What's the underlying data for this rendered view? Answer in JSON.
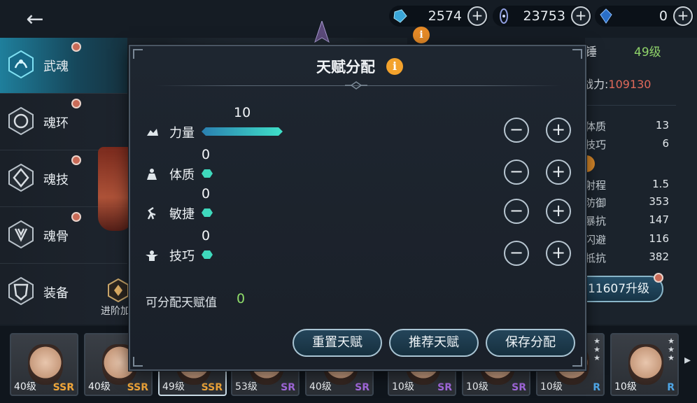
{
  "topbar": {
    "resources": [
      {
        "icon": "blue-crystal-icon",
        "value": "2574"
      },
      {
        "icon": "spirit-ring-icon",
        "value": "23753"
      },
      {
        "icon": "soul-gem-icon",
        "value": "0"
      }
    ],
    "plus_label": "+"
  },
  "sidebar": {
    "items": [
      {
        "label": "武魂",
        "icon": "martial-soul-icon",
        "active": true
      },
      {
        "label": "魂环",
        "icon": "soul-ring-icon",
        "active": false
      },
      {
        "label": "魂技",
        "icon": "soul-skill-icon",
        "active": false
      },
      {
        "label": "魂骨",
        "icon": "soul-bone-icon",
        "active": false
      },
      {
        "label": "装备",
        "icon": "equipment-icon",
        "active": false
      }
    ],
    "advance_label": "进阶加"
  },
  "right_panel": {
    "name_fragment": "锤",
    "level": "49级",
    "power_label": "战力:",
    "power_value": "109130",
    "stats": [
      {
        "name": "体质",
        "value": "13"
      },
      {
        "name": "技巧",
        "value": "6"
      },
      {
        "name": "射程",
        "value": "1.5"
      },
      {
        "name": "防御",
        "value": "353"
      },
      {
        "name": "暴抗",
        "value": "147"
      },
      {
        "name": "闪避",
        "value": "116"
      },
      {
        "name": "抵抗",
        "value": "382"
      }
    ],
    "upgrade_label": "11607升级"
  },
  "dialog": {
    "title": "天赋分配",
    "info_icon": "i",
    "attributes": [
      {
        "label": "力量",
        "icon": "strength-icon",
        "value": "10",
        "fill": 0.55
      },
      {
        "label": "体质",
        "icon": "constitution-icon",
        "value": "0",
        "fill": 0
      },
      {
        "label": "敏捷",
        "icon": "agility-icon",
        "value": "0",
        "fill": 0
      },
      {
        "label": "技巧",
        "icon": "technique-icon",
        "value": "0",
        "fill": 0
      }
    ],
    "minus_label": "−",
    "plus_label": "+",
    "available_label": "可分配天赋值",
    "available_value": "0",
    "buttons": {
      "reset": "重置天赋",
      "recommend": "推荐天赋",
      "save": "保存分配"
    }
  },
  "heroes": [
    {
      "level": "40级",
      "rarity": "SSR"
    },
    {
      "level": "40级",
      "rarity": "SSR"
    },
    {
      "level": "49级",
      "rarity": "SSR",
      "selected": true
    },
    {
      "level": "53级",
      "rarity": "SR"
    },
    {
      "level": "40级",
      "rarity": "SR"
    },
    {
      "level": "10级",
      "rarity": "SR"
    },
    {
      "level": "10级",
      "rarity": "SR"
    },
    {
      "level": "10级",
      "rarity": "R"
    },
    {
      "level": "10级",
      "rarity": "R"
    }
  ],
  "colors": {
    "accent_teal": "#2fc1c4",
    "level_green": "#8fd36a",
    "power_red": "#e0695a",
    "ssr_gold": "#f0a63a",
    "sr_purple": "#a46ae0",
    "r_blue": "#4ea6e6"
  }
}
